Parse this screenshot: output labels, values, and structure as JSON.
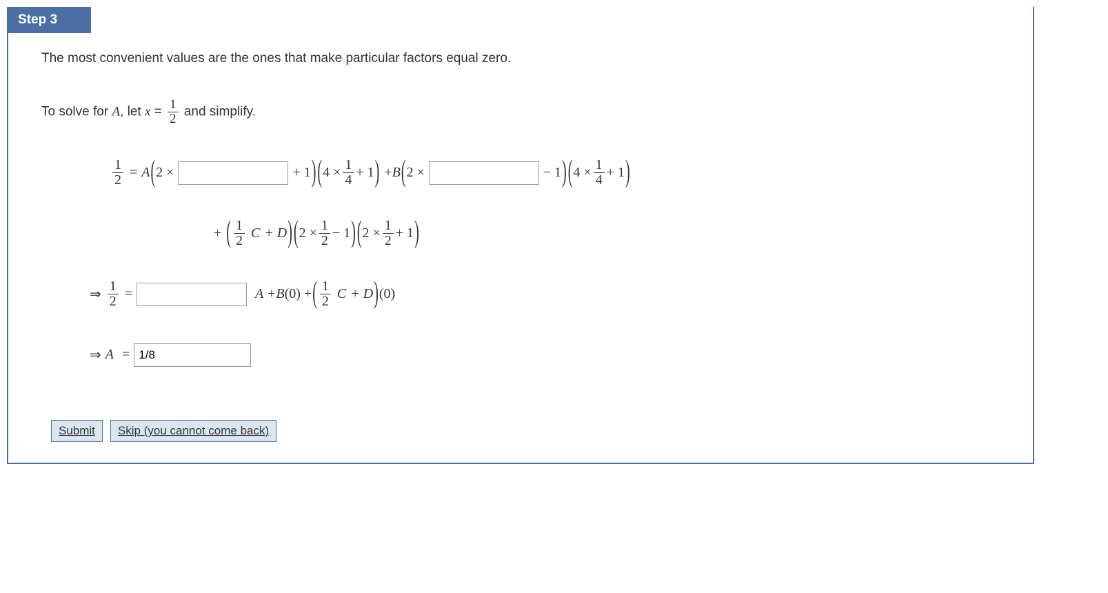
{
  "header": {
    "title": "Step 3"
  },
  "intro": "The most convenient values are the ones that make particular factors equal zero.",
  "solve": {
    "prefix": "To solve for ",
    "var": "A",
    "letx": ", let ",
    "xvar": "x",
    "eq": " = ",
    "frac_num": "1",
    "frac_den": "2",
    "suffix": " and simplify."
  },
  "line1": {
    "lhs_num": "1",
    "lhs_den": "2",
    "eq": "=",
    "A": "A",
    "open": "(",
    "two_x": "2 ×",
    "blank1": "",
    "plus1a": "+ 1",
    "close": ")",
    "p2_open": "(",
    "p2_4x": "4 ×",
    "p2_num": "1",
    "p2_den": "4",
    "p2_plus1": "+ 1",
    "p2_close": ")",
    "plus_B": "+ ",
    "B": "B",
    "b_open": "(",
    "b_2x": "2 ×",
    "blank2": "",
    "b_m1": "− 1",
    "b_close": ")",
    "p4_open": "(",
    "p4_4x": "4 ×",
    "p4_num": "1",
    "p4_den": "4",
    "p4_plus1": "+ 1",
    "p4_close": ")"
  },
  "line2": {
    "plus": "+",
    "po": "(",
    "num": "1",
    "den": "2",
    "C": "C",
    "pD": "+ D",
    "pc": ")",
    "g1o": "(",
    "g1_2x": "2 ×",
    "g1_num": "1",
    "g1_den": "2",
    "g1_m1": "− 1",
    "g1c": ")",
    "g2o": "(",
    "g2_2x": "2 ×",
    "g2_num": "1",
    "g2_den": "2",
    "g2_p1": "+ 1",
    "g2c": ")"
  },
  "line3": {
    "arrow": "⇒",
    "num": "1",
    "den": "2",
    "eq": "=",
    "blank": "",
    "A_plus": "A + ",
    "B": "B",
    "z1": "(0) + ",
    "po": "(",
    "pn": "1",
    "pd": "2",
    "C": "C",
    "pD": "+ D",
    "pc": ")",
    "z2": "(0)"
  },
  "line4": {
    "arrow": "⇒",
    "A": "A",
    "eq": "=",
    "value": "1/8"
  },
  "buttons": {
    "submit": "Submit",
    "skip": "Skip (you cannot come back)"
  }
}
